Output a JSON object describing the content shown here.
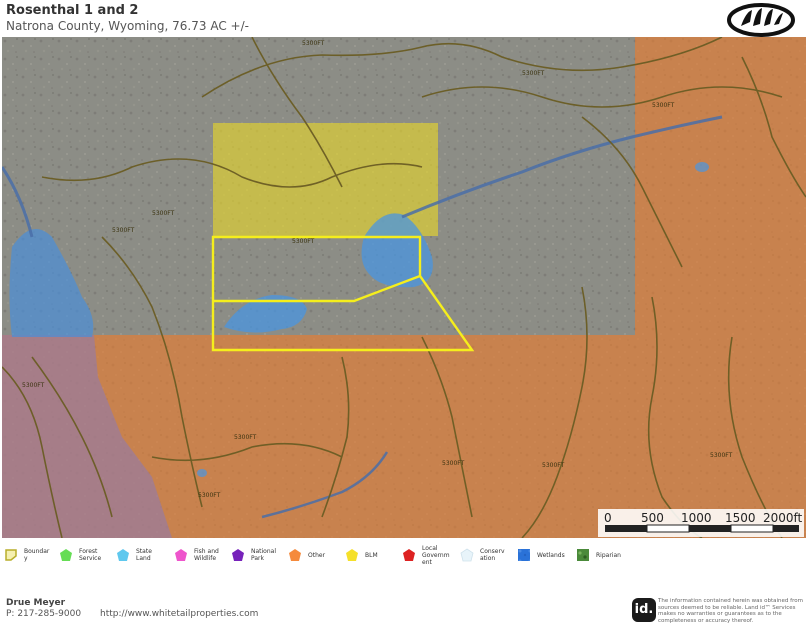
{
  "header": {
    "title": "Rosenthal 1 and 2",
    "subtitle": "Natrona County, Wyoming, 76.73 AC +/-"
  },
  "map": {
    "contour_label": "5300FT",
    "scale_labels": [
      "0",
      "500",
      "1000",
      "1500",
      "2000ft"
    ]
  },
  "legend": [
    {
      "label": "Boundary",
      "color": "#e8e070"
    },
    {
      "label": "Forest Service",
      "color": "#66dd55"
    },
    {
      "label": "State Land",
      "color": "#5fc8ee"
    },
    {
      "label": "Fish and Wildlife",
      "color": "#ee55cc"
    },
    {
      "label": "National Park",
      "color": "#7722bb"
    },
    {
      "label": "Other",
      "color": "#f58a3c"
    },
    {
      "label": "BLM",
      "color": "#f5e02a"
    },
    {
      "label": "Local Government",
      "color": "#dd2222"
    },
    {
      "label": "Conservation",
      "color": "#e8f4fa"
    },
    {
      "label": "Wetlands",
      "color": "#2a72d8"
    },
    {
      "label": "Riparian",
      "color": "#4a8a3a"
    }
  ],
  "footer": {
    "name": "Drue Meyer",
    "phone": "P: 217-285-9000",
    "url": "http://www.whitetailproperties.com",
    "id_logo": "id.",
    "disclaimer": "The information contained herein was obtained from sources deemed to be reliable. Land id™ Services makes no warranties or guarantees as to the completeness or accuracy thereof."
  }
}
